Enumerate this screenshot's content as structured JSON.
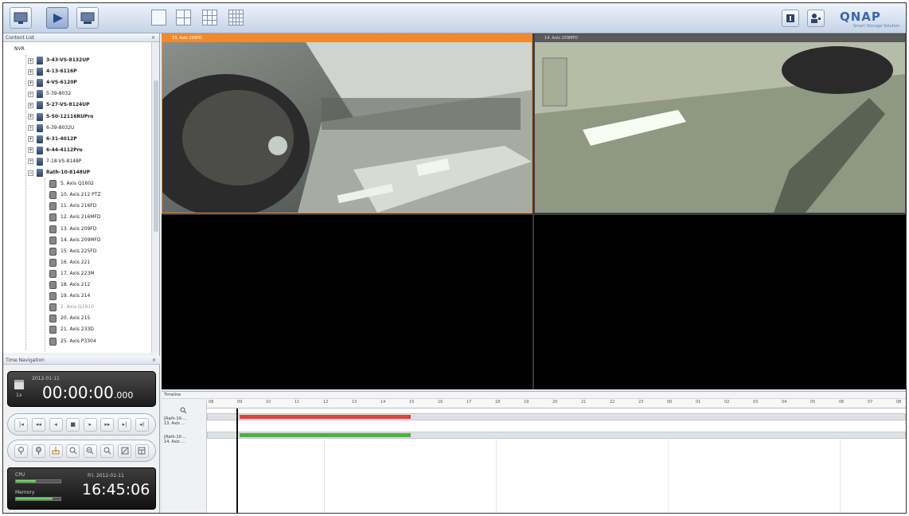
{
  "toolbar": {
    "view_icons": [
      "monitor-icon",
      "playback-icon",
      "device-icon"
    ],
    "layout_icons": [
      "layout-1x1-icon",
      "layout-2x2-icon",
      "layout-3x3-icon",
      "layout-4x4-icon"
    ],
    "right_icons": [
      "info-icon",
      "user-icon"
    ],
    "logo": "QNAP",
    "logo_sub": "Smart Storage Solution"
  },
  "content_list": {
    "title": "Content List",
    "root": "NVR",
    "folders": [
      {
        "label": "3-43-VS-8132UP",
        "bold": true
      },
      {
        "label": "4-13-6116P",
        "bold": true
      },
      {
        "label": "4-VS-6120P",
        "bold": true
      },
      {
        "label": "5-39-8032",
        "bold": false
      },
      {
        "label": "5-27-VS-8124UP",
        "bold": true
      },
      {
        "label": "5-50-12116RUPro",
        "bold": true
      },
      {
        "label": "6-39-8032U",
        "bold": false
      },
      {
        "label": "6-31-4012P",
        "bold": true
      },
      {
        "label": "6-44-4112Pro",
        "bold": true
      },
      {
        "label": "7-18-VS-8148P",
        "bold": false
      },
      {
        "label": "Rath-10-8148UP",
        "bold": true
      }
    ],
    "cameras": [
      {
        "label": "5. Axis Q1602",
        "dim": false
      },
      {
        "label": "10. Axis 212 PTZ",
        "dim": false
      },
      {
        "label": "11. Axis 216FD",
        "dim": false
      },
      {
        "label": "12. Axis 216MFD",
        "dim": false
      },
      {
        "label": "13. Axis 209FD",
        "dim": false
      },
      {
        "label": "14. Axis 209MFD",
        "dim": false
      },
      {
        "label": "15. Axis 225FD",
        "dim": false
      },
      {
        "label": "16. Axis 221",
        "dim": false
      },
      {
        "label": "17. Axis 223M",
        "dim": false
      },
      {
        "label": "18. Axis 212",
        "dim": false
      },
      {
        "label": "19. Axis 214",
        "dim": false
      },
      {
        "label": "2. Axis Q1910",
        "dim": true
      },
      {
        "label": "20. Axis 215",
        "dim": false
      },
      {
        "label": "21. Axis 233D",
        "dim": false
      },
      {
        "label": "25. Axis P3304",
        "dim": false
      }
    ]
  },
  "time_navigation": {
    "title": "Time Navigation",
    "date": "2012-01-11",
    "multiplier": "1x",
    "time": "00:00:00",
    "ms": ".000",
    "playback_buttons": [
      "|◂",
      "◂◂",
      "◂",
      "■",
      "▸",
      "▸▸",
      "▸|",
      "◂)"
    ],
    "tool_icons": [
      "pin-icon",
      "pin-alt-icon",
      "export-icon",
      "search-icon",
      "zoom-in-icon",
      "zoom-out-icon",
      "fit-icon",
      "calendar-icon"
    ]
  },
  "system": {
    "cpu_label": "CPU",
    "memory_label": "Memory",
    "cpu": 0.45,
    "memory": 0.82,
    "date": "Fri. 2012-01-11",
    "clock": "16:45:06"
  },
  "video": {
    "panes": [
      {
        "label": "13. Axis 209FD",
        "active": true
      },
      {
        "label": "14. Axis 209MFD",
        "active": false
      },
      {
        "label": "",
        "active": false
      },
      {
        "label": "",
        "active": false
      }
    ]
  },
  "timeline": {
    "title": "Timeline",
    "hours": [
      "08",
      "09",
      "10",
      "11",
      "12",
      "13",
      "14",
      "15",
      "16",
      "17",
      "18",
      "19",
      "20",
      "21",
      "22",
      "23",
      "00",
      "01",
      "02",
      "03",
      "04",
      "05",
      "06",
      "07",
      "08"
    ],
    "tracks": [
      {
        "label": "[Rath-10-...",
        "sublabel": "13. Axis ...",
        "color": "#d9443f",
        "start": 0.045,
        "end": 0.29
      },
      {
        "label": "[Rath-10-...",
        "sublabel": "14. Axis ...",
        "color": "#49b23c",
        "start": 0.045,
        "end": 0.29
      }
    ],
    "cursor": 0.042
  },
  "colors": {
    "active_pane": "#f08a2c",
    "accent": "#3d66a8"
  }
}
